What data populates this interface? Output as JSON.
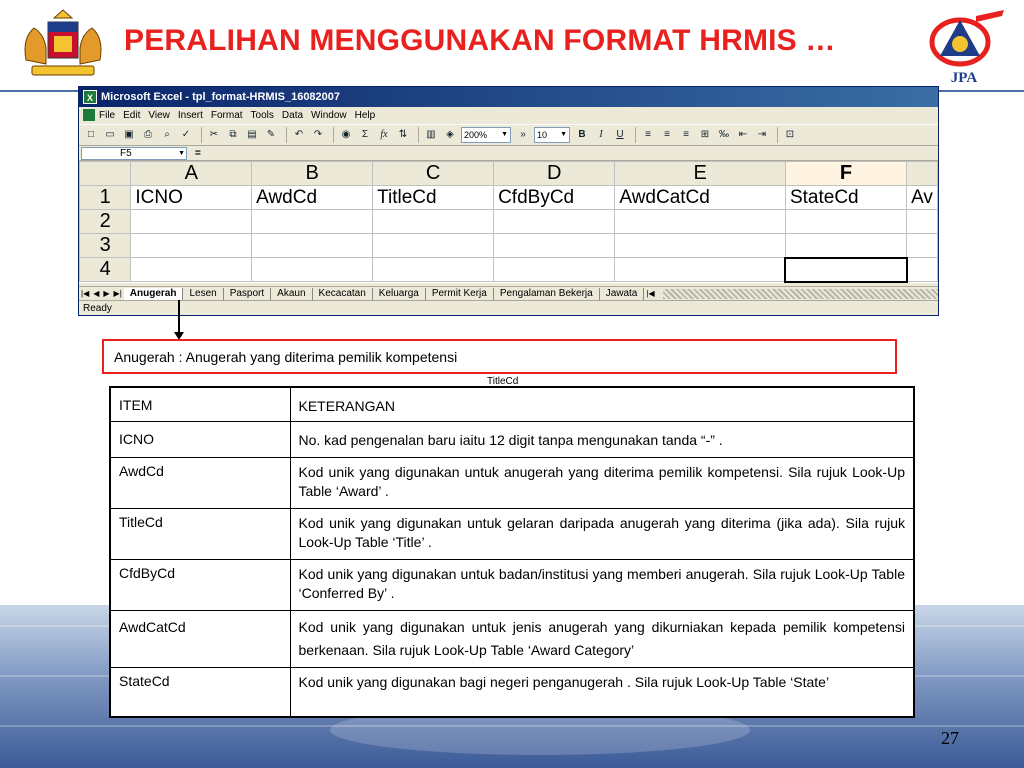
{
  "slide": {
    "title": "PERALIHAN MENGGUNAKAN FORMAT HRMIS …",
    "logo_right_text": "JPA",
    "page_number": "27"
  },
  "excel": {
    "window_title": "Microsoft Excel - tpl_format-HRMIS_16082007",
    "menu": [
      "File",
      "Edit",
      "View",
      "Insert",
      "Format",
      "Tools",
      "Data",
      "Window",
      "Help"
    ],
    "toolbar": {
      "zoom": "200%",
      "font_size": "10",
      "bold": "B",
      "italic": "I",
      "underline": "U",
      "sum": "Σ",
      "fx": "fx"
    },
    "name_box": "F5",
    "formula_eq": "=",
    "columns": [
      "A",
      "B",
      "C",
      "D",
      "E",
      "F"
    ],
    "rows": [
      {
        "num": "1",
        "cells": [
          "ICNO",
          "AwdCd",
          "TitleCd",
          "CfdByCd",
          "AwdCatCd",
          "StateCd",
          "Av"
        ]
      },
      {
        "num": "2",
        "cells": [
          "",
          "",
          "",
          "",
          "",
          "",
          ""
        ]
      },
      {
        "num": "3",
        "cells": [
          "",
          "",
          "",
          "",
          "",
          "",
          ""
        ]
      },
      {
        "num": "4",
        "cells": [
          "",
          "",
          "",
          "",
          "",
          "",
          ""
        ]
      }
    ],
    "sheet_tabs": [
      "Anugerah",
      "Lesen",
      "Pasport",
      "Akaun",
      "Kecacatan",
      "Keluarga",
      "Permit Kerja",
      "Pengalaman Bekerja",
      "Jawata"
    ],
    "status": "Ready"
  },
  "caption": "Anugerah : Anugerah yang diterima pemilik kompetensi",
  "tiny_label": "TitleCd",
  "definitions": {
    "header": {
      "item": "ITEM",
      "keterangan": "KETERANGAN"
    },
    "rows": [
      {
        "item": "ICNO",
        "keterangan": "No. kad pengenalan baru iaitu 12 digit tanpa mengunakan tanda “-” ."
      },
      {
        "item": "AwdCd",
        "keterangan": "Kod unik yang digunakan untuk anugerah yang diterima pemilik kompetensi. Sila rujuk Look-Up Table ‘Award’ ."
      },
      {
        "item": "TitleCd",
        "keterangan": "Kod unik yang digunakan untuk gelaran daripada anugerah yang diterima (jika ada). Sila rujuk Look-Up Table ‘Title’ ."
      },
      {
        "item": "CfdByCd",
        "keterangan": "Kod unik yang digunakan untuk badan/institusi yang memberi anugerah. Sila rujuk Look-Up Table ‘Conferred By’ ."
      },
      {
        "item": "AwdCatCd",
        "keterangan": "Kod unik yang digunakan untuk jenis anugerah yang dikurniakan kepada pemilik kompetensi berkenaan. Sila rujuk Look-Up Table ‘Award Category’"
      },
      {
        "item": "StateCd",
        "keterangan": "Kod unik yang digunakan bagi negeri penganugerah . Sila rujuk Look-Up Table ‘State’"
      }
    ]
  },
  "colors": {
    "title_red": "#e8201e",
    "rule_blue": "#4b6ea8",
    "excel_title_blue": "#0a246a"
  }
}
